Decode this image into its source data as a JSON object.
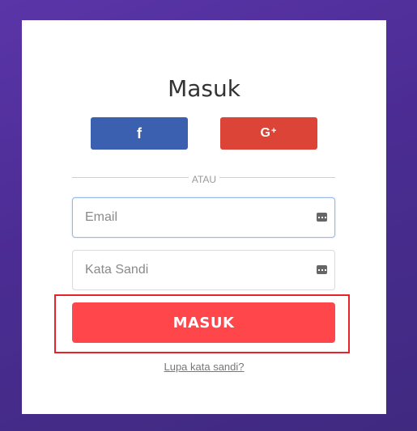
{
  "login": {
    "title": "Masuk",
    "social": {
      "facebook_icon": "f",
      "google_icon": "G",
      "google_plus": "+"
    },
    "divider_label": "ATAU",
    "email": {
      "value": "",
      "placeholder": "Email"
    },
    "password": {
      "value": "",
      "placeholder": "Kata Sandi"
    },
    "submit_label": "MASUK",
    "forgot_link": "Lupa kata sandi?"
  },
  "colors": {
    "background": "#4b2c93",
    "facebook": "#3b60b0",
    "google": "#dd4438",
    "submit": "#ff464b",
    "highlight_outline": "#e8222b"
  }
}
